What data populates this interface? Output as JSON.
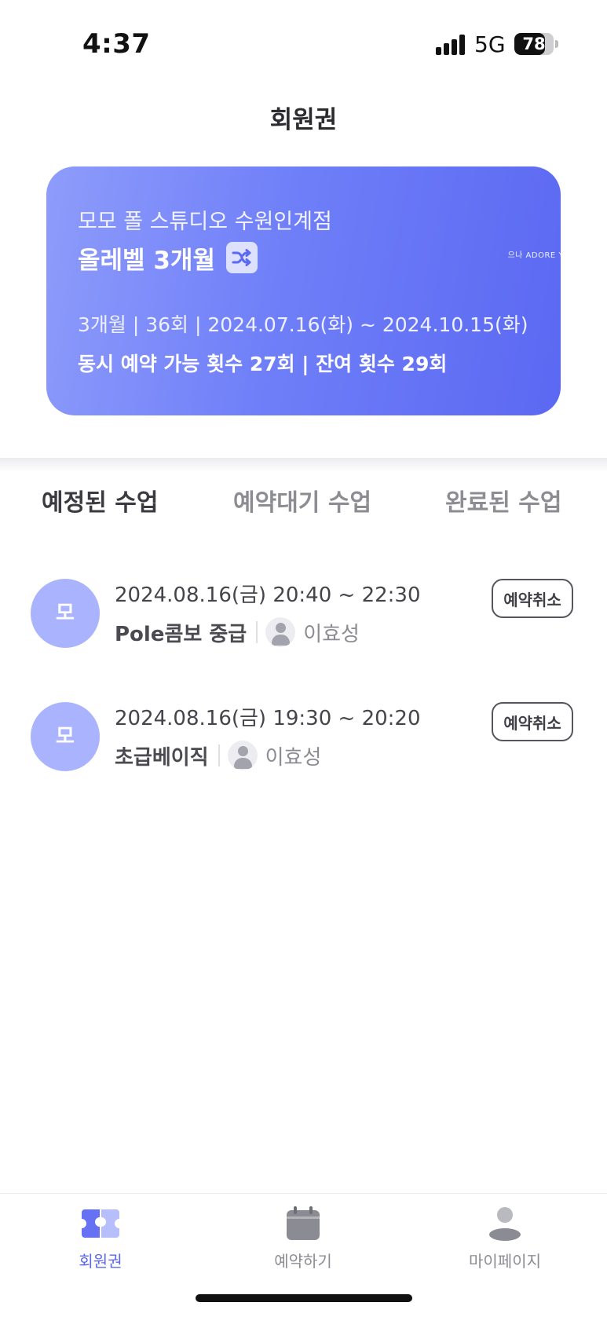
{
  "status_bar": {
    "time": "4:37",
    "network": "5G",
    "battery_level": "78",
    "battery_fraction": 0.78
  },
  "header": {
    "title": "회원권"
  },
  "membership": {
    "studio": "모모 폴 스튜디오 수원인계점",
    "plan": "올레벨 3개월",
    "watermark": "으나 ADORE Y",
    "period": "3개월 | 36회 | 2024.07.16(화) ~ 2024.10.15(화)",
    "counts": "동시 예약 가능 횟수 27회  |  잔여 횟수 29회",
    "switch_icon": "shuffle-icon"
  },
  "tabs": [
    {
      "label": "예정된 수업",
      "active": true
    },
    {
      "label": "예약대기 수업",
      "active": false
    },
    {
      "label": "완료된 수업",
      "active": false
    }
  ],
  "classes": [
    {
      "avatar": "모",
      "time": "2024.08.16(금) 20:40 ~ 22:30",
      "name": "Pole콤보 중급",
      "instructor": "이효성",
      "action": "예약취소"
    },
    {
      "avatar": "모",
      "time": "2024.08.16(금) 19:30 ~ 20:20",
      "name": "초급베이직",
      "instructor": "이효성",
      "action": "예약취소"
    }
  ],
  "nav": [
    {
      "label": "회원권",
      "icon": "ticket-icon",
      "active": true
    },
    {
      "label": "예약하기",
      "icon": "calendar-icon",
      "active": false
    },
    {
      "label": "마이페이지",
      "icon": "user-icon",
      "active": false
    }
  ],
  "colors": {
    "accent": "#5b68f2",
    "card_start": "#8e9cfb",
    "card_end": "#5b68f2",
    "avatar": "#aab3fd"
  }
}
